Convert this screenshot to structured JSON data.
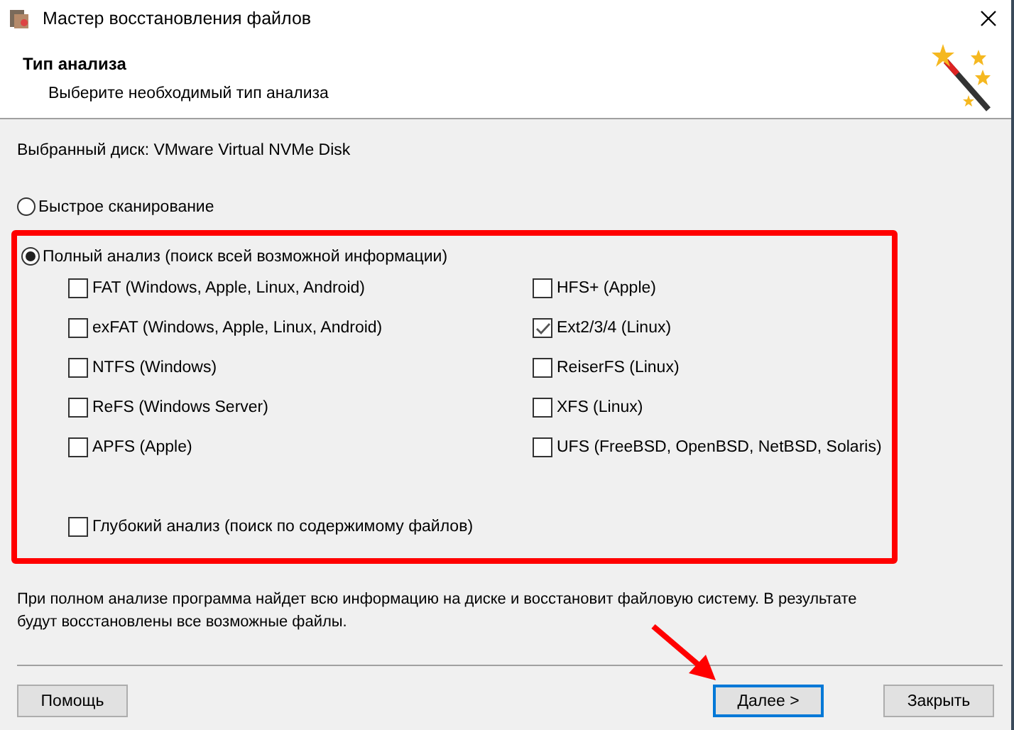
{
  "window": {
    "title": "Мастер восстановления файлов"
  },
  "header": {
    "title": "Тип анализа",
    "subtitle": "Выберите необходимый тип анализа"
  },
  "disk_label": "Выбранный диск: VMware Virtual NVMe Disk",
  "quick_scan": {
    "label": "Быстрое сканирование",
    "selected": false
  },
  "full_analysis": {
    "label": "Полный анализ (поиск всей возможной информации)",
    "selected": true
  },
  "filesystem_columns": [
    {
      "items": [
        {
          "label": "FAT (Windows, Apple, Linux, Android)",
          "checked": false
        },
        {
          "label": "exFAT (Windows, Apple, Linux, Android)",
          "checked": false
        },
        {
          "label": "NTFS (Windows)",
          "checked": false
        },
        {
          "label": "ReFS (Windows Server)",
          "checked": false
        },
        {
          "label": "APFS (Apple)",
          "checked": false
        }
      ]
    },
    {
      "items": [
        {
          "label": "HFS+ (Apple)",
          "checked": false
        },
        {
          "label": "Ext2/3/4 (Linux)",
          "checked": true
        },
        {
          "label": "ReiserFS (Linux)",
          "checked": false
        },
        {
          "label": "XFS (Linux)",
          "checked": false
        },
        {
          "label": "UFS (FreeBSD, OpenBSD, NetBSD, Solaris)",
          "checked": false
        }
      ]
    }
  ],
  "deep_analysis": {
    "label": "Глубокий анализ (поиск по содержимому файлов)",
    "checked": false
  },
  "description": "При полном анализе программа найдет всю информацию на диске и восстановит файловую систему. В результате будут восстановлены все возможные файлы.",
  "buttons": [
    {
      "label": "Помощь",
      "focused": false
    },
    {
      "label": "Далее >",
      "focused": true
    },
    {
      "label": "Закрыть",
      "focused": false
    }
  ]
}
